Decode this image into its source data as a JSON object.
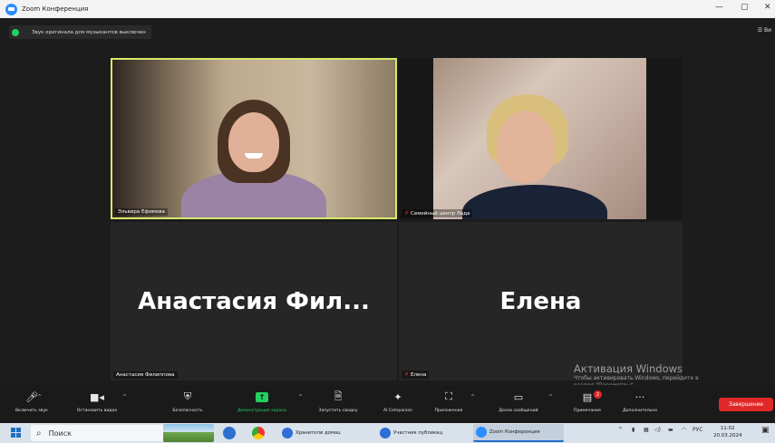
{
  "window": {
    "title": "Zoom Конференция",
    "minimize_glyph": "—",
    "maximize_glyph": "▢",
    "close_glyph": "✕"
  },
  "notice": {
    "text": "Звук оригинала для музыкантов выключен"
  },
  "view_button": {
    "label": "☰ Ви"
  },
  "participants": [
    {
      "name": "Эльвира Ефимова",
      "video": true,
      "muted": false,
      "active_speaker": true
    },
    {
      "name": "Семейный центр Лада",
      "video": true,
      "muted": true,
      "active_speaker": false
    },
    {
      "name": "Анастасия Филиппова",
      "display_name": "Анастасия  Фил...",
      "video": false,
      "muted": false
    },
    {
      "name": "Елена",
      "display_name": "Елена",
      "video": false,
      "muted": true
    }
  ],
  "activation": {
    "title": "Активация Windows",
    "line1": "Чтобы активировать Windows, перейдите в",
    "line2": "раздел \"Параметры\"."
  },
  "toolbar": {
    "unmute": "Включить звук",
    "stop_video": "Остановить видео",
    "security": "Безопасность",
    "share_screen": "Демонстрация экрана",
    "start_summary": "Запустить сводку",
    "ai_companion": "AI Companion",
    "apps": "Приложения",
    "whiteboards": "Доски сообщений",
    "notes": "Примечание",
    "more": "Дополнительно",
    "end": "Завершение",
    "notes_badge": "2"
  },
  "taskbar": {
    "search_placeholder": "Поиск",
    "apps": [
      {
        "label": "Хранители домашн...",
        "color": "#2d6fd6"
      },
      {
        "label": "Участник публикац...",
        "color": "#2d6fd6"
      },
      {
        "label": "Zoom Конференция",
        "color": "#2d8cff"
      }
    ],
    "lang": "РУС",
    "time": "11:02",
    "date": "20.03.2024"
  },
  "colors": {
    "active_speaker_border": "#d8e86a",
    "share_green": "#23d160",
    "end_red": "#e02828",
    "mute_red": "#e02828"
  }
}
